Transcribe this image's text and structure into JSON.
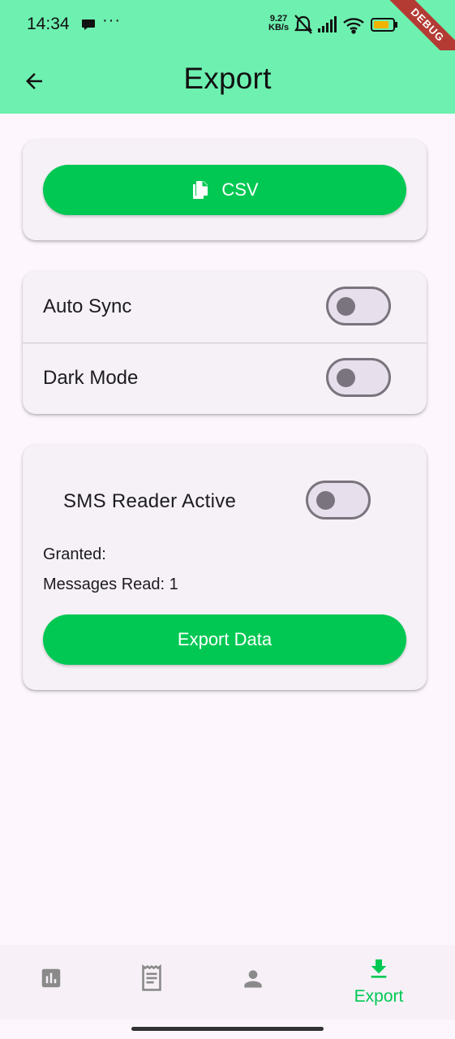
{
  "status_bar": {
    "time": "14:34",
    "dots": "···",
    "speed_value": "9.27",
    "speed_unit": "KB/s",
    "icons": [
      "message-icon",
      "bell-off-icon",
      "signal-icon",
      "wifi-icon",
      "battery-icon"
    ]
  },
  "debug_banner": "DEBUG",
  "app_bar": {
    "title": "Export",
    "back_icon": "arrow-back-icon"
  },
  "export_card": {
    "csv_label": "CSV",
    "csv_icon": "file-copy-icon"
  },
  "settings_card": {
    "auto_sync": {
      "label": "Auto Sync",
      "on": false
    },
    "dark_mode": {
      "label": "Dark Mode",
      "on": false
    }
  },
  "sms_card": {
    "label": "SMS Reader Active",
    "on": false,
    "granted": "Granted:",
    "messages_read": "Messages Read: 1",
    "export_label": "Export Data"
  },
  "bottom_nav": {
    "items": [
      {
        "icon": "bar-chart-icon",
        "label": "",
        "active": false
      },
      {
        "icon": "receipt-icon",
        "label": "",
        "active": false
      },
      {
        "icon": "person-icon",
        "label": "",
        "active": false
      },
      {
        "icon": "download-icon",
        "label": "Export",
        "active": true
      }
    ]
  },
  "colors": {
    "app_bar": "#6ef0b0",
    "accent": "#00c853",
    "background": "#fdf7fd",
    "card": "#f6f1f6",
    "nav_inactive": "#8a8a8a"
  }
}
